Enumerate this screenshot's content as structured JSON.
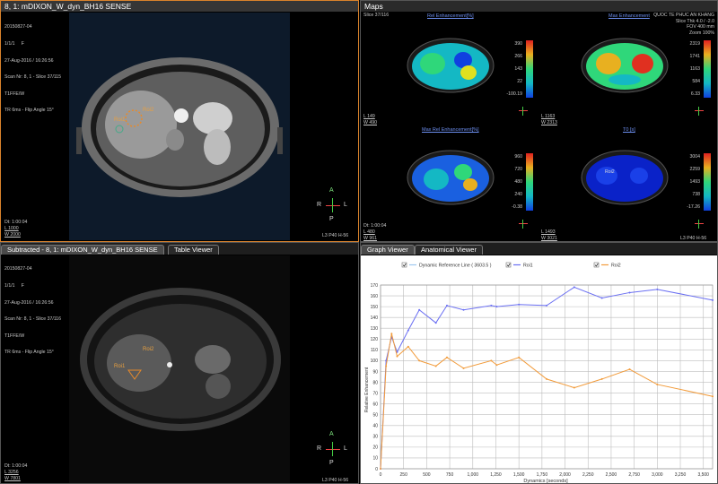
{
  "top_left": {
    "title": "8, 1: mDIXON_W_dyn_BH16 SENSE",
    "info": [
      "20150827-04",
      "1/1/1     F",
      "27-Aug-2016 / 16:26:56",
      "Scan Nr: 8, 1 - Slice 37/115",
      "T1FFE/W",
      "TR 6ms - Flip Angle 15°"
    ],
    "roi1": "Roi1",
    "roi2": "Roi2",
    "dt": "Dt: 1:00:04",
    "wl": "L 1000",
    "ww": "W 2000",
    "footer": "L3 P40 H-56",
    "orient": {
      "top": "A",
      "bottom": "P",
      "left": "R",
      "right": "L"
    }
  },
  "maps": {
    "title": "Maps",
    "slice": "Slice 37/116",
    "hospital": [
      "QUOC TE PHUC AN KHANG",
      "Slice Thk 4.0 / -2.0",
      "FOV 400 mm",
      "Zoom 100%"
    ],
    "panels": [
      {
        "label": "Rel Enhancement[%]",
        "scale": [
          "390",
          "266",
          "143",
          "22",
          "-100.19"
        ]
      },
      {
        "label": "Max Enhancement",
        "scale": [
          "2319",
          "1741",
          "1163",
          "584",
          "6.33"
        ]
      },
      {
        "label": "Max Rel Enhancement[%]",
        "scale": [
          "960",
          "720",
          "480",
          "240",
          "-0.38"
        ]
      },
      {
        "label": "T0 [s]",
        "scale": [
          "3004",
          "2259",
          "1493",
          "738",
          "-17.26"
        ]
      }
    ],
    "wl": [
      "L 149",
      "W 490",
      "L 1163",
      "W 2313",
      "L 480",
      "W 961",
      "L 1493",
      "W 3021"
    ],
    "roi2": "Roi2",
    "dt": "Dt: 1:00:04",
    "footer": "L3 P40 H-56"
  },
  "bottom_left": {
    "title": "Subtracted - 8, 1: mDIXON_W_dyn_BH16 SENSE",
    "tab2": "Table Viewer",
    "info": [
      "20150827-04",
      "1/1/1     F",
      "27-Aug-2016 / 16:26:56",
      "Scan Nr: 8, 1 - Slice 37/116",
      "T1FFE/W",
      "TR 6ms - Flip Angle 15°"
    ],
    "roi1": "Roi1",
    "roi2": "Roi2",
    "dt": "Dt: 1:00:04",
    "wl": "L 3256",
    "ww": "W 7801",
    "footer": "L3 P40 H-56",
    "orient": {
      "top": "A",
      "bottom": "P",
      "left": "R",
      "right": "L"
    }
  },
  "graph": {
    "tab1": "Graph Viewer",
    "tab2": "Anatomical Viewer",
    "legend": [
      "Dynamic Reference Line ( 3603.5 )",
      "Roi1",
      "Roi2"
    ],
    "ylabel": "Relative Enhancement",
    "xlabel": "Dynamics [seconds]"
  },
  "chart_data": {
    "type": "line",
    "xlabel": "Dynamics [seconds]",
    "ylabel": "Relative Enhancement",
    "xlim": [
      0,
      3600
    ],
    "ylim": [
      0,
      170
    ],
    "xticks": [
      "0",
      "250",
      "500",
      "750",
      "1,000",
      "1,250",
      "1,500",
      "1,750",
      "2,000",
      "2,250",
      "2,500",
      "2,750",
      "3,000",
      "3,250",
      "3,500"
    ],
    "yticks": [
      "0",
      "10",
      "20",
      "30",
      "40",
      "50",
      "60",
      "70",
      "80",
      "90",
      "100",
      "110",
      "120",
      "130",
      "140",
      "150",
      "160",
      "170"
    ],
    "grid": true,
    "legend_position": "top",
    "series": [
      {
        "name": "Roi1",
        "color": "#6a6ff2",
        "x": [
          0,
          60,
          120,
          180,
          300,
          420,
          600,
          720,
          900,
          1200,
          1260,
          1500,
          1800,
          2100,
          2400,
          2700,
          3000,
          3600
        ],
        "y": [
          0,
          100,
          122,
          108,
          128,
          147,
          135,
          151,
          147,
          151,
          150,
          152,
          151,
          168,
          158,
          163,
          166,
          156
        ]
      },
      {
        "name": "Roi2",
        "color": "#f29b3a",
        "x": [
          0,
          60,
          120,
          180,
          300,
          420,
          600,
          720,
          900,
          1200,
          1260,
          1500,
          1800,
          2100,
          2400,
          2700,
          3000,
          3600
        ],
        "y": [
          0,
          95,
          125,
          104,
          113,
          100,
          95,
          103,
          93,
          100,
          96,
          103,
          83,
          75,
          83,
          92,
          78,
          67
        ]
      }
    ]
  }
}
